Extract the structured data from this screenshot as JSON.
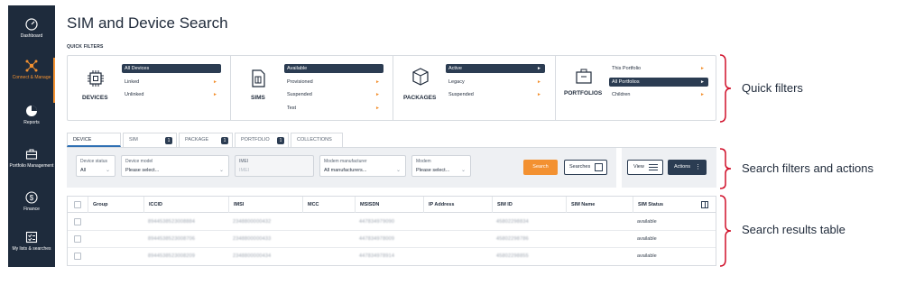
{
  "sidebar": {
    "items": [
      {
        "label": "Dashboard",
        "icon": "dashboard-icon"
      },
      {
        "label": "Connect & Manage",
        "icon": "network-icon",
        "active": true
      },
      {
        "label": "Reports",
        "icon": "pie-chart-icon"
      },
      {
        "label": "Portfolio Management",
        "icon": "briefcase-icon"
      },
      {
        "label": "Finance",
        "icon": "dollar-icon"
      },
      {
        "label": "My lists & searches",
        "icon": "checklist-icon"
      }
    ],
    "accent": "#f39131",
    "background": "#1e2b3c"
  },
  "page": {
    "title": "SIM and Device Search"
  },
  "quick_filters": {
    "label": "QUICK FILTERS",
    "groups": [
      {
        "title": "DEVICES",
        "icon": "chip-icon",
        "options": [
          {
            "label": "All Devices",
            "selected": true,
            "arrow": false
          },
          {
            "label": "Linked",
            "selected": false,
            "arrow": true
          },
          {
            "label": "Unlinked",
            "selected": false,
            "arrow": true
          }
        ]
      },
      {
        "title": "SIMS",
        "icon": "sim-card-icon",
        "options": [
          {
            "label": "Available",
            "selected": true,
            "arrow": false
          },
          {
            "label": "Provisioned",
            "selected": false,
            "arrow": true
          },
          {
            "label": "Suspended",
            "selected": false,
            "arrow": true
          },
          {
            "label": "Test",
            "selected": false,
            "arrow": true
          }
        ]
      },
      {
        "title": "PACKAGES",
        "icon": "package-icon",
        "options": [
          {
            "label": "Active",
            "selected": true,
            "arrow": true
          },
          {
            "label": "Legacy",
            "selected": false,
            "arrow": true
          },
          {
            "label": "Suspended",
            "selected": false,
            "arrow": true
          }
        ]
      },
      {
        "title": "PORTFOLIOS",
        "icon": "briefcase-icon",
        "options": [
          {
            "label": "This Portfolio",
            "selected": false,
            "arrow": true
          },
          {
            "label": "All Portfolios",
            "selected": true,
            "arrow": true
          },
          {
            "label": "Children",
            "selected": false,
            "arrow": true
          }
        ]
      }
    ]
  },
  "tabs": [
    {
      "label": "DEVICE",
      "badge": "",
      "active": true
    },
    {
      "label": "SIM",
      "badge": "1",
      "active": false
    },
    {
      "label": "PACKAGE",
      "badge": "1",
      "active": false
    },
    {
      "label": "PORTFOLIO",
      "badge": "1",
      "active": false
    },
    {
      "label": "COLLECTIONS",
      "badge": "",
      "active": false
    }
  ],
  "filters": {
    "device_status": {
      "label": "Device status",
      "value": "All"
    },
    "device_model": {
      "label": "Device model",
      "value": "Please select..."
    },
    "imei": {
      "label": "IMEI",
      "placeholder": "IMEI"
    },
    "modem_manufacturer": {
      "label": "Modem manufacturer",
      "value": "All manufacturers..."
    },
    "modem": {
      "label": "Modem",
      "value": "Please select..."
    },
    "search_label": "Search",
    "searches_label": "Searches",
    "view_label": "View",
    "actions_label": "Actions"
  },
  "table": {
    "columns": [
      "Group",
      "ICCID",
      "IMSI",
      "MCC",
      "MSISDN",
      "IP Address",
      "SIM ID",
      "SIM Name",
      "SIM Status"
    ],
    "rows": [
      {
        "iccid": "8944538523008884",
        "imsi": "2348800000432",
        "msisdn": "447834979090",
        "sim_id": "45802298834",
        "status": "available"
      },
      {
        "iccid": "8944538523008706",
        "imsi": "2348800000433",
        "msisdn": "447834978009",
        "sim_id": "45802298786",
        "status": "available"
      },
      {
        "iccid": "8944538523008209",
        "imsi": "2348800000434",
        "msisdn": "447834978914",
        "sim_id": "45802298855",
        "status": "available"
      }
    ]
  },
  "annotations": {
    "quick_filters": "Quick filters",
    "search_filters": "Search filters and actions",
    "results_table": "Search results table",
    "brace_color": "#d0102a"
  }
}
